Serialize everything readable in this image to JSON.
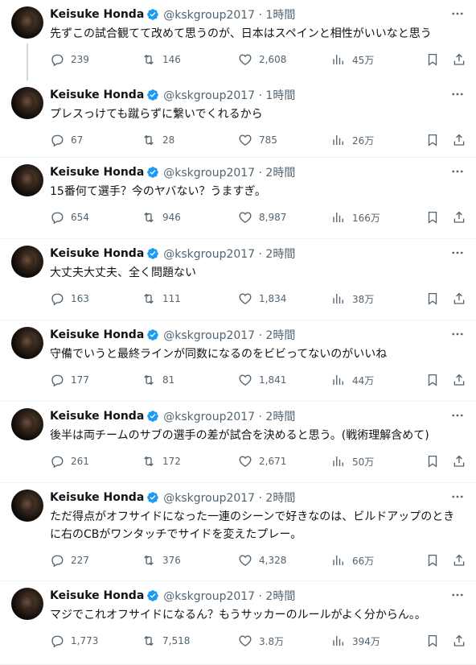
{
  "author": {
    "name": "Keisuke Honda",
    "handle": "@kskgroup2017",
    "separator": "·"
  },
  "tweets": [
    {
      "time": "1時間",
      "text": "先ずこの試合観てて改めて思うのが、日本はスペインと相性がいいなと思う",
      "replies": "239",
      "retweets": "146",
      "likes": "2,608",
      "views": "45万"
    },
    {
      "time": "1時間",
      "text": "プレスっけても蹴らずに繋いでくれるから",
      "replies": "67",
      "retweets": "28",
      "likes": "785",
      "views": "26万"
    },
    {
      "time": "2時間",
      "text": "15番何て選手？今のヤバない？うますぎ。",
      "replies": "654",
      "retweets": "946",
      "likes": "8,987",
      "views": "166万"
    },
    {
      "time": "2時間",
      "text": "大丈夫大丈夫、全く問題ない",
      "replies": "163",
      "retweets": "111",
      "likes": "1,834",
      "views": "38万"
    },
    {
      "time": "2時間",
      "text": "守備でいうと最終ラインが同数になるのをビビってないのがいいね",
      "replies": "177",
      "retweets": "81",
      "likes": "1,841",
      "views": "44万"
    },
    {
      "time": "2時間",
      "text": "後半は両チームのサブの選手の差が試合を決めると思う。(戦術理解含めて)",
      "replies": "261",
      "retweets": "172",
      "likes": "2,671",
      "views": "50万"
    },
    {
      "time": "2時間",
      "text": "ただ得点がオフサイドになった一連のシーンで好きなのは、ビルドアップのときに右のCBがワンタッチでサイドを変えたプレー。",
      "replies": "227",
      "retweets": "376",
      "likes": "4,328",
      "views": "66万"
    },
    {
      "time": "2時間",
      "text": "マジでこれオフサイドになるん？もうサッカーのルールがよく分からん。。",
      "replies": "1,773",
      "retweets": "7,518",
      "likes": "3.8万",
      "views": "394万"
    }
  ],
  "colors": {
    "text": "#0f1419",
    "secondary": "#536471",
    "verified": "#1d9bf0",
    "divider": "#eff3f4",
    "thread_line": "#cfd9de"
  },
  "icons": [
    "verified-badge-icon",
    "more-dots-icon",
    "reply-icon",
    "retweet-icon",
    "like-icon",
    "views-icon",
    "bookmark-icon",
    "share-icon"
  ]
}
